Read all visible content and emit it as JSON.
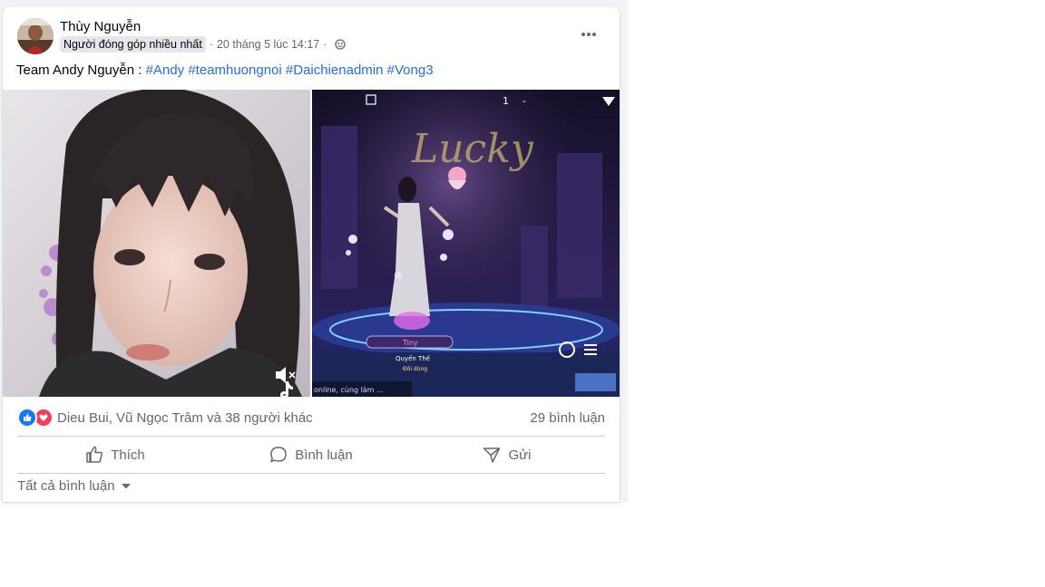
{
  "post": {
    "author": "Thùy Nguyễn",
    "badge": "Người đóng góp nhiều nhất",
    "timestamp": "20 tháng 5 lúc 14:17",
    "separator": "·",
    "text_prefix": "Team Andy Nguyễn : ",
    "hashtags": [
      "#Andy",
      "#teamhuongnoi",
      "#Daichienadmin",
      "#Vong3"
    ],
    "photos": [
      "portrait-photo",
      "game-screenshot"
    ],
    "game_overlay": {
      "player_tag": "Tiny",
      "subtitle": "Quyến Thế",
      "sub2": "Đôi dùng",
      "chat_text": "online, cùng làm ...",
      "room": "1",
      "lock": "-"
    }
  },
  "stats": {
    "reactors": "Dieu Bui, Vũ Ngọc Trâm và 38 người khác",
    "comments": "29 bình luận"
  },
  "actions": {
    "like": "Thích",
    "comment": "Bình luận",
    "share": "Gửi"
  },
  "comments_filter": "Tất cả bình luận",
  "colors": {
    "accent": "#1877f2",
    "love": "#f33e58",
    "hashtag": "#216fdb",
    "muted": "#65676b"
  }
}
